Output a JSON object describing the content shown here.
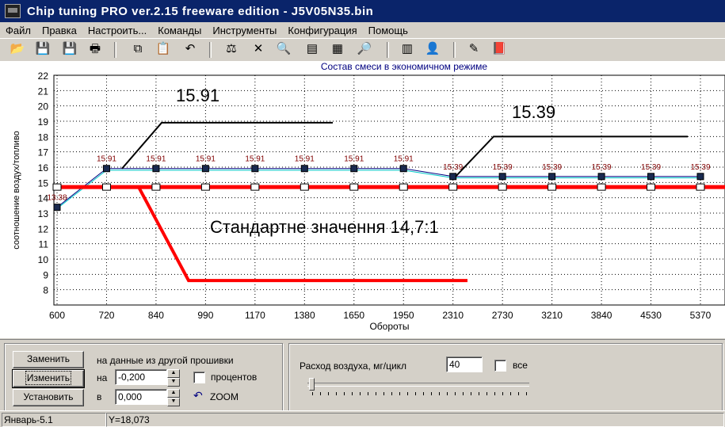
{
  "window": {
    "title": "Chip tuning PRO ver.2.15 freeware edition  -  J5V05N35.bin"
  },
  "menu": [
    "Файл",
    "Правка",
    "Настроить...",
    "Команды",
    "Инструменты",
    "Конфигурация",
    "Помощь"
  ],
  "toolbar": [
    {
      "icon": "open-folder-icon",
      "glyph": "📂"
    },
    {
      "icon": "save-icon",
      "glyph": "💾"
    },
    {
      "icon": "save-as-icon",
      "glyph": "💾"
    },
    {
      "icon": "print-icon",
      "glyph": "🖶"
    },
    {
      "icon": "copy-icon",
      "glyph": "⧉"
    },
    {
      "icon": "paste-icon",
      "glyph": "📋"
    },
    {
      "icon": "undo-icon",
      "glyph": "↶"
    },
    {
      "icon": "scales-icon",
      "glyph": "⚖"
    },
    {
      "icon": "cut-icon",
      "glyph": "✕"
    },
    {
      "icon": "find-icon",
      "glyph": "🔍"
    },
    {
      "icon": "table-view-icon",
      "glyph": "▤"
    },
    {
      "icon": "config-icon",
      "glyph": "▦"
    },
    {
      "icon": "zoom-icon",
      "glyph": "🔎"
    },
    {
      "icon": "chip-icon",
      "glyph": "▥"
    },
    {
      "icon": "user-icon",
      "glyph": "👤"
    },
    {
      "icon": "wizard-icon",
      "glyph": "✎"
    },
    {
      "icon": "book-icon",
      "glyph": "📕"
    }
  ],
  "chart_data": {
    "type": "line",
    "title": "Состав смеси в экономичном режиме",
    "xlabel": "Обороты",
    "ylabel": "соотношение воздух/топливо",
    "categories": [
      "600",
      "720",
      "840",
      "990",
      "1170",
      "1380",
      "1650",
      "1950",
      "2310",
      "2730",
      "3210",
      "3840",
      "4530",
      "5370"
    ],
    "ylim": [
      7,
      22
    ],
    "yticks": [
      8,
      9,
      10,
      11,
      12,
      13,
      14,
      15,
      16,
      17,
      18,
      19,
      20,
      21,
      22
    ],
    "grid": true,
    "series": [
      {
        "values": [
          13.38,
          15.91,
          15.91,
          15.91,
          15.91,
          15.91,
          15.91,
          15.91,
          15.39,
          15.39,
          15.39,
          15.39,
          15.39,
          15.39
        ],
        "labels": [
          "13.38",
          "15.91",
          "15.91",
          "15.91",
          "15.91",
          "15.91",
          "15.91",
          "15.91",
          "15.39",
          "15.39",
          "15.39",
          "15.39",
          "15.39",
          "15.39"
        ],
        "color": "#000080"
      },
      {
        "values": [
          14.7,
          14.7,
          14.7,
          14.7,
          14.7,
          14.7,
          14.7,
          14.7,
          14.7,
          14.7,
          14.7,
          14.7,
          14.7,
          14.7
        ],
        "color": "#000000"
      },
      {
        "values": [
          13.3,
          15.8,
          15.8,
          15.8,
          15.8,
          15.8,
          15.8,
          15.8,
          15.3,
          15.3,
          15.3,
          15.3,
          15.3,
          15.3
        ],
        "color": "#00c8c8"
      }
    ],
    "annotations": [
      {
        "text": "15.91"
      },
      {
        "text": "15.39"
      },
      {
        "text": "Стандартне значення 14,7:1"
      }
    ],
    "colors": {
      "label": "#800000",
      "title": "#000080",
      "stoich": "#ff0000",
      "callout": "#000000"
    }
  },
  "lower": {
    "replace_button": "Заменить",
    "change_button": "Изменить",
    "set_button": "Установить",
    "other_firmware_label": "на данные из другой прошивки",
    "on_label": "на",
    "on_value": "-0,200",
    "percent_label": "процентов",
    "in_label": "в",
    "in_value": "0,000",
    "zoom_label": "ZOOM",
    "airflow_label": "Расход воздуха, мг/цикл",
    "airflow_value": "40",
    "all_label": "все"
  },
  "status": {
    "left": "Январь-5.1",
    "right": "Y=18,073"
  }
}
